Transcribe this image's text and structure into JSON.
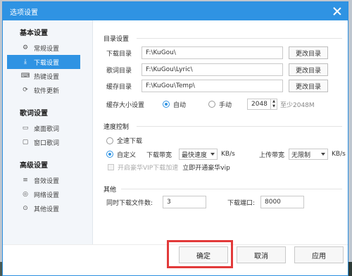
{
  "window": {
    "title": "选项设置"
  },
  "sidebar": {
    "groups": [
      {
        "title": "基本设置",
        "items": [
          {
            "label": "常规设置",
            "icon": "gear-icon"
          },
          {
            "label": "下载设置",
            "icon": "download-icon",
            "active": true
          },
          {
            "label": "热键设置",
            "icon": "keyboard-icon"
          },
          {
            "label": "软件更新",
            "icon": "update-icon"
          }
        ]
      },
      {
        "title": "歌词设置",
        "items": [
          {
            "label": "桌面歌词",
            "icon": "desktop-lyric-icon"
          },
          {
            "label": "窗口歌词",
            "icon": "window-lyric-icon"
          }
        ]
      },
      {
        "title": "高级设置",
        "items": [
          {
            "label": "音效设置",
            "icon": "equalizer-icon"
          },
          {
            "label": "网络设置",
            "icon": "network-icon"
          },
          {
            "label": "其他设置",
            "icon": "more-icon"
          }
        ]
      }
    ]
  },
  "dirs": {
    "section": "目录设置",
    "rows": [
      {
        "label": "下载目录",
        "value": "F:\\KuGou\\",
        "button": "更改目录"
      },
      {
        "label": "歌词目录",
        "value": "F:\\KuGou\\Lyric\\",
        "button": "更改目录"
      },
      {
        "label": "缓存目录",
        "value": "F:\\KuGou\\Temp\\",
        "button": "更改目录"
      }
    ],
    "cache_label": "缓存大小设置",
    "auto": "自动",
    "manual": "手动",
    "cache_value": "2048",
    "cache_hint": "至少2048M"
  },
  "speed": {
    "section": "速度控制",
    "full": "全速下载",
    "custom": "自定义",
    "down_label": "下载带宽",
    "down_value": "最快速度",
    "down_unit": "KB/s",
    "up_label": "上传带宽",
    "up_value": "无限制",
    "up_unit": "KB/s",
    "vip_label": "开启豪华VIP下载加速",
    "vip_link": "立即开通豪华vip"
  },
  "other": {
    "section": "其他",
    "concurrent_label": "同时下载文件数:",
    "concurrent_value": "3",
    "port_label": "下载端口:",
    "port_value": "8000"
  },
  "footer": {
    "ok": "确定",
    "cancel": "取消",
    "apply": "应用"
  },
  "colors": {
    "accent": "#2f93e3",
    "highlight": "#e23a3a"
  }
}
